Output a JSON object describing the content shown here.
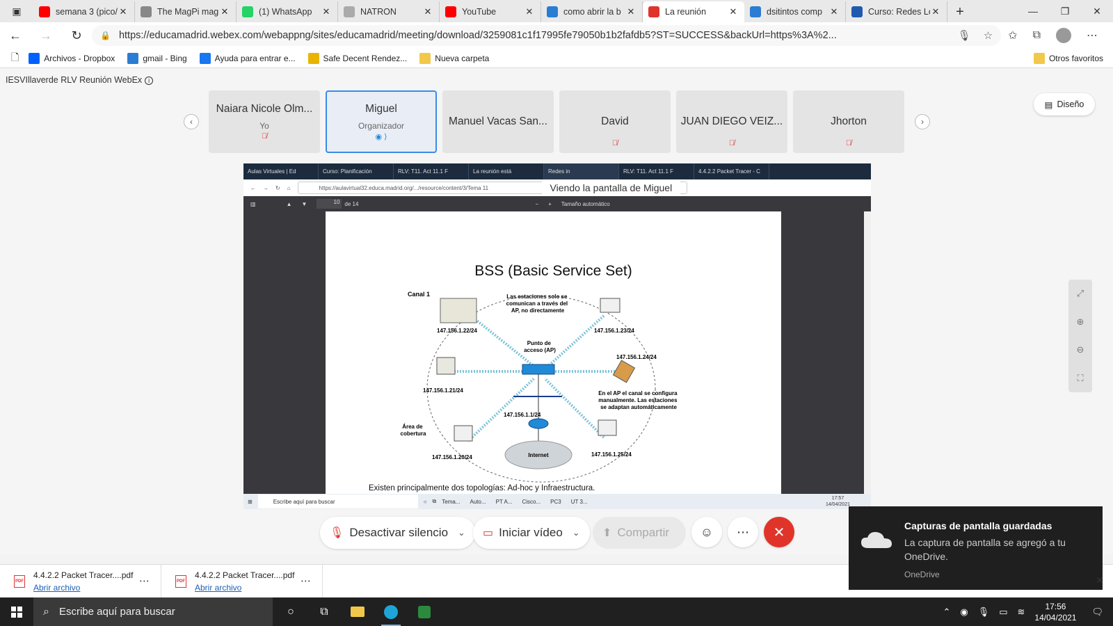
{
  "browser": {
    "tabs": [
      {
        "title": "semana 3 (pico/",
        "favicon": "youtube-icon",
        "color": "#ff0000",
        "active": false
      },
      {
        "title": "The MagPi mag",
        "favicon": "magpi-icon",
        "color": "#888888",
        "active": false
      },
      {
        "title": "(1) WhatsApp",
        "favicon": "whatsapp-icon",
        "color": "#25d366",
        "active": false
      },
      {
        "title": "NATRON",
        "favicon": "natron-icon",
        "color": "#aaaaaa",
        "active": false
      },
      {
        "title": "YouTube",
        "favicon": "youtube-icon",
        "color": "#ff0000",
        "active": false
      },
      {
        "title": "como abrir la b",
        "favicon": "bing-icon",
        "color": "#2b7cd3",
        "active": false
      },
      {
        "title": "La reunión",
        "favicon": "webex-icon",
        "color": "#e0342b",
        "active": true
      },
      {
        "title": "dsitintos comp",
        "favicon": "bing-icon",
        "color": "#2b7cd3",
        "active": false
      },
      {
        "title": "Curso: Redes Lo",
        "favicon": "moodle-icon",
        "color": "#1f5ab0",
        "active": false
      }
    ],
    "url": "https://educamadrid.webex.com/webappng/sites/educamadrid/meeting/download/3259081c1f17995fe79050b1b2fafdb5?ST=SUCCESS&backUrl=https%3A%2...",
    "bookmarks": [
      {
        "label": "Archivos - Dropbox",
        "icon": "dropbox-icon"
      },
      {
        "label": "gmail - Bing",
        "icon": "bing-icon"
      },
      {
        "label": "Ayuda para entrar e...",
        "icon": "facebook-icon"
      },
      {
        "label": "Safe Decent Rendez...",
        "icon": "rendezvous-icon"
      },
      {
        "label": "Nueva carpeta",
        "icon": "folder-icon"
      }
    ],
    "other_bookmarks": "Otros favoritos"
  },
  "meeting": {
    "title": "IESVIllaverde RLV Reunión WebEx",
    "layout_button": "Diseño",
    "participants": [
      {
        "name": "Naiara Nicole Olm...",
        "role": "Yo",
        "muted": true
      },
      {
        "name": "Miguel",
        "role": "Organizador",
        "muted": false,
        "selected": true
      },
      {
        "name": "Manuel Vacas San...",
        "role": "",
        "muted": false
      },
      {
        "name": "David",
        "role": "",
        "muted": true
      },
      {
        "name": "JUAN DIEGO VEIZ...",
        "role": "",
        "muted": true
      },
      {
        "name": "Jhorton",
        "role": "",
        "muted": true
      }
    ],
    "viewing_label": "Viendo la pantalla de Miguel"
  },
  "shared": {
    "tabs": [
      "Aulas Virtuales | Ed",
      "Curso: Planificación",
      "RLV: T11. Act 11.1 F",
      "La reunión está",
      "Redes in",
      "RLV: T11. Act 11.1 F",
      "4.4.2.2 Packet Tracer - C"
    ],
    "url": "https://aulavirtual32.educa.madrid.org/.../resource/content/3/Tema 11",
    "page_number": "10",
    "page_total": "de 14",
    "zoom": "Tamaño automático",
    "slide_title": "BSS (Basic Service Set)",
    "diagram": {
      "canal": "Canal 1",
      "note_top": [
        "Las estaciones solo se",
        "comunican a través del",
        "AP, no directamente"
      ],
      "ap_label": [
        "Punto de",
        "acceso (AP)"
      ],
      "note_right": [
        "En el AP el canal se configura",
        "manualmente. Las estaciones",
        "se adaptan automáticamente"
      ],
      "area": [
        "Área de",
        "cobertura"
      ],
      "router_ip": "147.156.1.1/24",
      "internet": "Internet",
      "ips": [
        "147.156.1.22/24",
        "147.156.1.23/24",
        "147.156.1.24/24",
        "147.156.1.21/24",
        "147.156.1.20/24",
        "147.156.1.25/24"
      ]
    },
    "caption": "Existen principalmente dos topologías: Ad-hoc y Infraestructura.",
    "taskbar_search": "Escribe aquí para buscar",
    "taskbar_apps": [
      "Tema...",
      "Auto...",
      "PT A...",
      "Cisco...",
      "PC3",
      "UT 3..."
    ],
    "clock_time": "17:57",
    "clock_date": "14/04/2021"
  },
  "controls": {
    "mute": "Desactivar silencio",
    "video": "Iniciar vídeo",
    "share": "Compartir"
  },
  "toast": {
    "title": "Capturas de pantalla guardadas",
    "body": "La captura de pantalla se agregó a tu OneDrive.",
    "source": "OneDrive"
  },
  "downloads": [
    {
      "name": "4.4.2.2 Packet Tracer....pdf",
      "action": "Abrir archivo"
    },
    {
      "name": "4.4.2.2 Packet Tracer....pdf",
      "action": "Abrir archivo"
    }
  ],
  "taskbar": {
    "search": "Escribe aquí para buscar",
    "time": "17:56",
    "date": "14/04/2021"
  }
}
